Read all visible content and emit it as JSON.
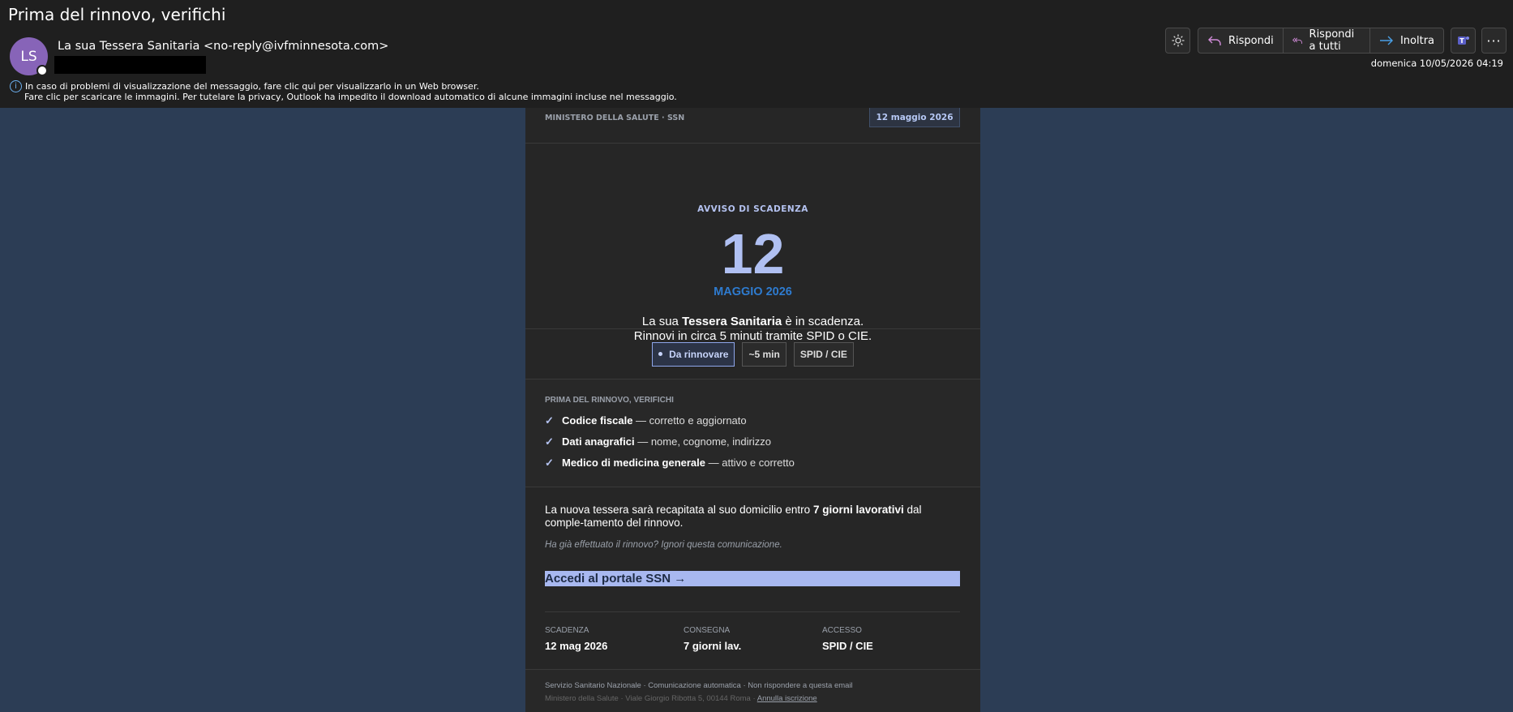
{
  "email": {
    "subject": "Prima del rinnovo, verifichi",
    "avatar_initials": "LS",
    "from": "La sua Tessera Sanitaria <no-reply@ivfminnesota.com>",
    "date": "domenica 10/05/2026 04:19",
    "info_line1": "In caso di problemi di visualizzazione del messaggio, fare clic qui per visualizzarlo in un Web browser.",
    "info_line2": "Fare clic per scaricare le immagini. Per tutelare la privacy, Outlook ha impedito il download automatico di alcune immagini incluse nel messaggio."
  },
  "toolbar": {
    "reply": "Rispondi",
    "reply_all": "Rispondi a tutti",
    "forward": "Inoltra"
  },
  "message": {
    "ministry": "MINISTERO DELLA SALUTE · SSN",
    "date_badge": "12 maggio 2026",
    "notice_label": "AVVISO DI SCADENZA",
    "day": "12",
    "month": "MAGGIO 2026",
    "msg_pre": "La sua ",
    "msg_bold": "Tessera Sanitaria",
    "msg_post": " è in scadenza.",
    "msg_line2": "Rinnovi in circa 5 minuti tramite SPID o CIE.",
    "pills": [
      "Da rinnovare",
      "~5 min",
      "SPID / CIE"
    ],
    "check_title": "PRIMA DEL RINNOVO, VERIFICHI",
    "checks": [
      {
        "bold": "Codice fiscale",
        "text": " — corretto e aggiornato"
      },
      {
        "bold": "Dati anagrafici",
        "text": " — nome, cognome, indirizzo"
      },
      {
        "bold": "Medico di medicina generale",
        "text": " — attivo e corretto"
      }
    ],
    "delivery_pre": "La nuova tessera sarà recapitata al suo domicilio entro ",
    "delivery_bold": "7 giorni lavorativi",
    "delivery_post": " dal comple-tamento del rinnovo.",
    "ignore": "Ha già effettuato il rinnovo? Ignori questa comunicazione.",
    "cta": "Accedi al portale SSN →",
    "stats": [
      {
        "label": "SCADENZA",
        "value": "12 mag 2026"
      },
      {
        "label": "CONSEGNA",
        "value": "7 giorni lav."
      },
      {
        "label": "ACCESSO",
        "value": "SPID / CIE"
      }
    ],
    "footer_line1": "Servizio Sanitario Nazionale · Comunicazione automatica · Non rispondere a questa email",
    "footer_line2": "Ministero della Salute · Viale Giorgio Ribotta 5, 00144 Roma · ",
    "unsubscribe": "Annulla iscrizione"
  }
}
